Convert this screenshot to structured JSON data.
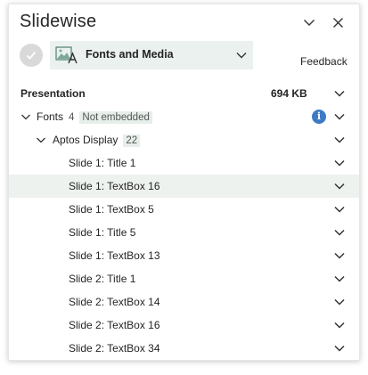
{
  "header": {
    "title": "Slidewise"
  },
  "toolbar": {
    "dropdown_label": "Fonts and Media",
    "feedback_label": "Feedback"
  },
  "presentation": {
    "label": "Presentation",
    "size": "694 KB"
  },
  "fonts": {
    "label": "Fonts",
    "count": "4",
    "status": "Not embedded",
    "info_glyph": "i"
  },
  "font_family": {
    "label": "Aptos Display",
    "count": "22"
  },
  "items": [
    {
      "label": "Slide 1: Title 1",
      "selected": false
    },
    {
      "label": "Slide 1: TextBox 16",
      "selected": true
    },
    {
      "label": "Slide 1: TextBox 5",
      "selected": false
    },
    {
      "label": "Slide 1: Title 5",
      "selected": false
    },
    {
      "label": "Slide 1: TextBox 13",
      "selected": false
    },
    {
      "label": "Slide 2: Title 1",
      "selected": false
    },
    {
      "label": "Slide 2: TextBox 14",
      "selected": false
    },
    {
      "label": "Slide 2: TextBox 16",
      "selected": false
    },
    {
      "label": "Slide 2: TextBox 34",
      "selected": false
    }
  ],
  "colors": {
    "selected_row": "#eef2ef",
    "dropdown_bg": "#eaf1ee",
    "info_blue": "#3d7bc4"
  }
}
